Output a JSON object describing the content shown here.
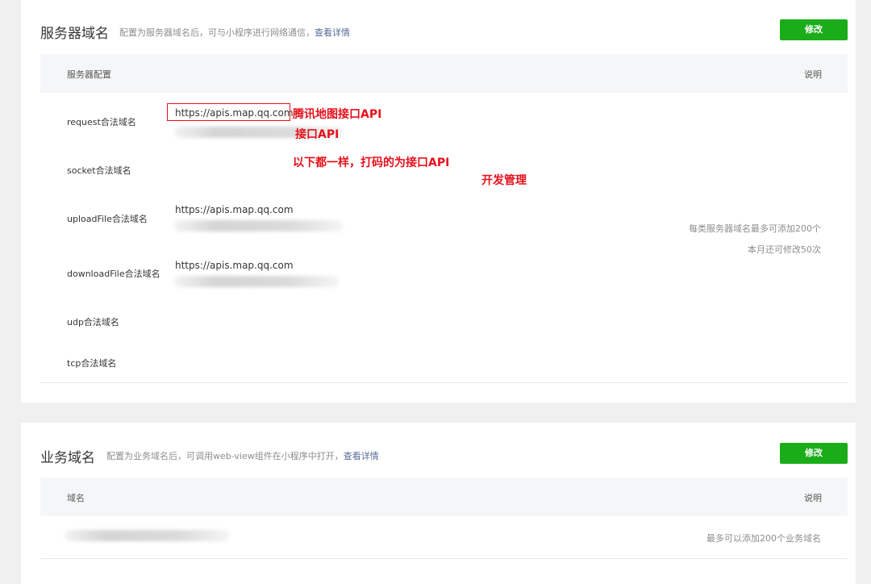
{
  "server_domain": {
    "title": "服务器域名",
    "desc": "配置为服务器域名后，可与小程序进行网络通信，",
    "detail_link": "查看详情",
    "edit_label": "修改",
    "table_head": {
      "config": "服务器配置",
      "note": "说明"
    },
    "rows": [
      {
        "label": "request合法域名",
        "url": "https://apis.map.qq.com"
      },
      {
        "label": "socket合法域名",
        "url": ""
      },
      {
        "label": "uploadFile合法域名",
        "url": "https://apis.map.qq.com"
      },
      {
        "label": "downloadFile合法域名",
        "url": "https://apis.map.qq.com"
      },
      {
        "label": "udp合法域名",
        "url": ""
      },
      {
        "label": "tcp合法域名",
        "url": ""
      }
    ],
    "notes": {
      "limit": "每类服务器域名最多可添加200个",
      "monthly": "本月还可修改50次"
    }
  },
  "annotations": {
    "tencent_map_api": "腾讯地图接口API",
    "interface_api": "接口API",
    "same_below": "以下都一样，打码的为接口API",
    "dev_management": "开发管理",
    "color": "#e8101b"
  },
  "business_domain": {
    "title": "业务域名",
    "desc": "配置为业务域名后，可调用web-view组件在小程序中打开，",
    "detail_link": "查看详情",
    "edit_label": "修改",
    "table_head": {
      "domain": "域名",
      "note": "说明"
    },
    "note": "最多可以添加200个业务域名"
  },
  "colors": {
    "accent_green": "#1aad19",
    "link": "#576b95",
    "background": "#f0f0f0"
  }
}
